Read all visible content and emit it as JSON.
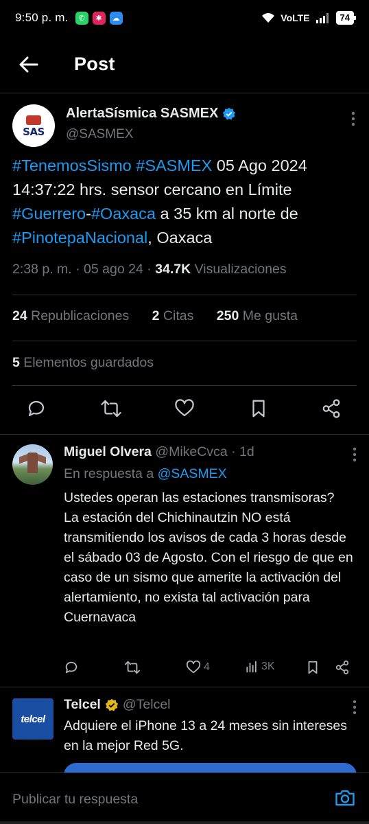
{
  "status_bar": {
    "time": "9:50 p. m.",
    "network": "VoLTE",
    "battery": "74",
    "apps": [
      "whatsapp-icon",
      "app-icon",
      "cloud-icon"
    ]
  },
  "header": {
    "title": "Post"
  },
  "post": {
    "author_name": "AlertaSísmica SASMEX",
    "author_handle": "@SASMEX",
    "avatar_text": "SAS",
    "text_parts": [
      {
        "text": "#TenemosSismo",
        "tag": true
      },
      {
        "text": " ",
        "tag": false
      },
      {
        "text": "#SASMEX",
        "tag": true
      },
      {
        "text": " 05 Ago 2024 14:37:22 hrs. sensor cercano en Límite ",
        "tag": false
      },
      {
        "text": "#Guerrero",
        "tag": true
      },
      {
        "text": "-",
        "tag": false
      },
      {
        "text": "#Oaxaca",
        "tag": true
      },
      {
        "text": " a 35 km al norte de ",
        "tag": false
      },
      {
        "text": "#PinotepaNacional",
        "tag": true
      },
      {
        "text": ", Oaxaca",
        "tag": false
      }
    ],
    "timestamp": "2:38 p. m. · 05 ago 24 · ",
    "views_count": "34.7K",
    "views_label": " Visualizaciones",
    "reposts_count": "24",
    "reposts_label": "Republicaciones",
    "quotes_count": "2",
    "quotes_label": "Citas",
    "likes_count": "250",
    "likes_label": "Me gusta",
    "bookmarks_count": "5",
    "bookmarks_label": "Elementos guardados"
  },
  "reply": {
    "name": "Miguel Olvera",
    "handle": "@MikeCvca",
    "time": " · 1d",
    "reply_to_label": "En respuesta a ",
    "reply_to_handle": "@SASMEX",
    "text": "Ustedes operan las estaciones transmisoras?\nLa estación del Chichinautzin NO está transmitiendo los avisos de cada 3 horas desde el sábado 03 de Agosto. Con el riesgo de que en caso de un sismo que amerite la activación del alertamiento, no exista tal activación para Cuernavaca",
    "likes": "4",
    "views": "3K"
  },
  "ad": {
    "name": "Telcel",
    "handle": "@Telcel",
    "logo_text": "telcel",
    "text": "Adquiere el iPhone 13 a 24 meses sin intereses en la mejor Red 5G."
  },
  "composer": {
    "placeholder": "Publicar tu respuesta"
  },
  "colors": {
    "background": "#000000",
    "text": "#e7e9ea",
    "muted": "#71767b",
    "link": "#1d9bf0",
    "divider": "#2f3336",
    "verified_blue": "#1d9bf0",
    "verified_gold": "#e2b719"
  }
}
